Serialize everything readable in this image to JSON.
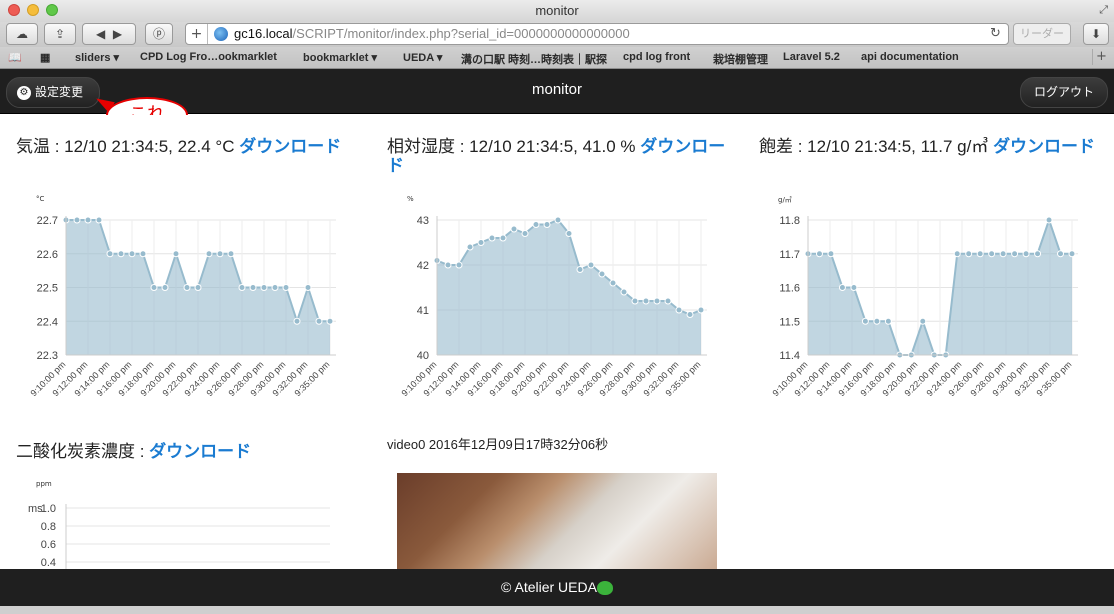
{
  "browser": {
    "window_title": "monitor",
    "url_host": "gc16.local",
    "url_path": "/SCRIPT/monitor/index.php?serial_id=0000000000000000",
    "reader_label": "リーダー",
    "bookmarks": [
      "sliders ▾",
      "CPD Log Fro…ookmarklet",
      "bookmarklet ▾",
      "UEDA ▾",
      "溝の口駅 時刻…時刻表｜駅探",
      "cpd log front",
      "栽培棚管理",
      "Laravel 5.2",
      "api documentation"
    ]
  },
  "header": {
    "settings_label": "設定変更",
    "title": "monitor",
    "logout_label": "ログアウト"
  },
  "callout": "これ",
  "panels": {
    "temp": {
      "title": "気温 : 12/10 21:34:5, 22.4 °C ",
      "link": "ダウンロード",
      "unit": "°C"
    },
    "humidity": {
      "title": "相対湿度 : 12/10 21:34:5, 41.0 % ",
      "link": "ダウンロード",
      "unit": "%"
    },
    "deficit": {
      "title": "飽差 : 12/10 21:34:5, 11.7 g/㎥ ",
      "link": "ダウンロード",
      "unit": "g/㎥"
    },
    "co2": {
      "title": "二酸化炭素濃度 : ",
      "link": "ダウンロード",
      "unit": "ppm"
    }
  },
  "video": {
    "caption": "video0 2016年12月09日17時32分06秒"
  },
  "footer": {
    "text": "© Atelier UEDA"
  },
  "chart_data": [
    {
      "type": "area",
      "ylabel": "°C",
      "ylim": [
        22.3,
        22.7
      ],
      "yticks": [
        "22.3",
        "22.4",
        "22.5",
        "22.6",
        "22.7"
      ],
      "xticks": [
        "9:10:00 pm",
        "9:12:00 pm",
        "9:14:00 pm",
        "9:16:00 pm",
        "9:18:00 pm",
        "9:20:00 pm",
        "9:22:00 pm",
        "9:24:00 pm",
        "9:26:00 pm",
        "9:28:00 pm",
        "9:30:00 pm",
        "9:32:00 pm",
        "9:35:00 pm"
      ],
      "values": [
        22.7,
        22.7,
        22.7,
        22.7,
        22.6,
        22.6,
        22.6,
        22.6,
        22.5,
        22.5,
        22.6,
        22.5,
        22.5,
        22.6,
        22.6,
        22.6,
        22.5,
        22.5,
        22.5,
        22.5,
        22.5,
        22.4,
        22.5,
        22.4,
        22.4
      ]
    },
    {
      "type": "area",
      "ylabel": "%",
      "ylim": [
        40,
        43
      ],
      "yticks": [
        "40",
        "41",
        "42",
        "43"
      ],
      "xticks": [
        "9:10:00 pm",
        "9:12:00 pm",
        "9:14:00 pm",
        "9:16:00 pm",
        "9:18:00 pm",
        "9:20:00 pm",
        "9:22:00 pm",
        "9:24:00 pm",
        "9:26:00 pm",
        "9:28:00 pm",
        "9:30:00 pm",
        "9:32:00 pm",
        "9:35:00 pm"
      ],
      "values": [
        42.1,
        42.0,
        42.0,
        42.4,
        42.5,
        42.6,
        42.6,
        42.8,
        42.7,
        42.9,
        42.9,
        43.0,
        42.7,
        41.9,
        42.0,
        41.8,
        41.6,
        41.4,
        41.2,
        41.2,
        41.2,
        41.2,
        41.0,
        40.9,
        41.0
      ]
    },
    {
      "type": "area",
      "ylabel": "g/㎥",
      "ylim": [
        11.4,
        11.8
      ],
      "yticks": [
        "11.4",
        "11.5",
        "11.6",
        "11.7",
        "11.8"
      ],
      "xticks": [
        "9:10:00 pm",
        "9:12:00 pm",
        "9:14:00 pm",
        "9:16:00 pm",
        "9:18:00 pm",
        "9:20:00 pm",
        "9:22:00 pm",
        "9:24:00 pm",
        "9:26:00 pm",
        "9:28:00 pm",
        "9:30:00 pm",
        "9:32:00 pm",
        "9:35:00 pm"
      ],
      "values": [
        11.7,
        11.7,
        11.7,
        11.6,
        11.6,
        11.5,
        11.5,
        11.5,
        11.4,
        11.4,
        11.5,
        11.4,
        11.4,
        11.7,
        11.7,
        11.7,
        11.7,
        11.7,
        11.7,
        11.7,
        11.7,
        11.8,
        11.7,
        11.7
      ]
    },
    {
      "type": "line",
      "ylabel": "ppm",
      "ylim": [
        0.4,
        1.0
      ],
      "yticks": [
        "1.0",
        "0.8",
        "0.6",
        "0.4"
      ],
      "overlay_text": "ms",
      "values": []
    }
  ]
}
